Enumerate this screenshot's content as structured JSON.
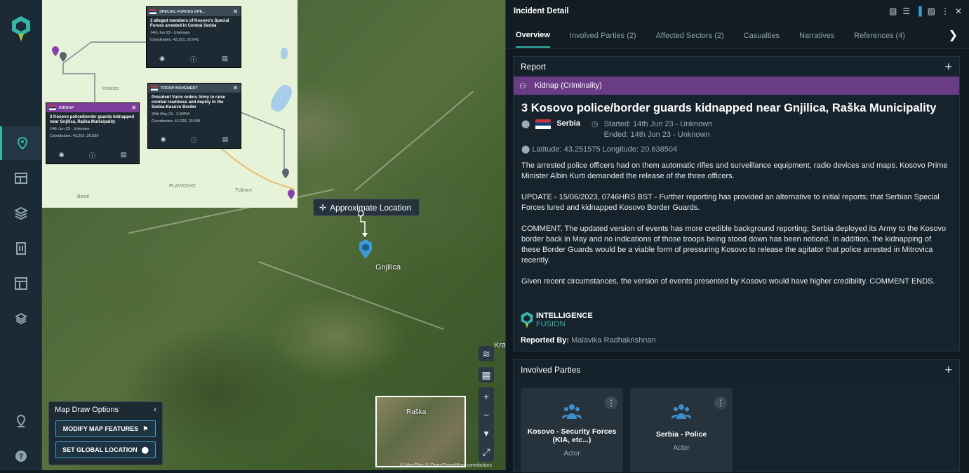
{
  "sidebar": {
    "items": [
      "map",
      "dashboard",
      "layers",
      "buildings",
      "layout",
      "stack",
      "location",
      "help"
    ]
  },
  "inset": {
    "labels": {
      "kravice": "Kravice",
      "plavkovo": "PLAVKOVO",
      "tusnice": "Tušnice",
      "bocin": "Bocin"
    },
    "cards": [
      {
        "tag": "SPECIAL FORCES OPE...",
        "title": "3 alleged members of Kosovo's Special Forces arrested in Central Serbia",
        "date": "14th Jun 23 - Unknown",
        "coords": "Coordinates: 43.251, 20.641"
      },
      {
        "tag": "TROOP MOVEMENT",
        "title": "President Vucic orders Army to raise combat readiness and deploy to the Serbia-Kosovo Border",
        "date": "26th May 23 - 2:00PM",
        "coords": "Coordinates: 43.228, 20.698"
      },
      {
        "tag": "KIDNAP",
        "title": "3 Kosovo police/border guards kidnapped near Gnjilica, Raška Municipality",
        "date": "14th Jun 23 - Unknown",
        "coords": "Coordinates: 43.252, 20.639"
      }
    ]
  },
  "map": {
    "approx_label": "Approximate Location",
    "place_label": "Gnjilica",
    "edge_label": "Kra",
    "minimap_label": "Raška",
    "attribution": "© MapTiler © OpenStreetMap contributors"
  },
  "draw_options": {
    "title": "Map Draw Options",
    "modify": "MODIFY MAP FEATURES",
    "set_global": "SET GLOBAL LOCATION"
  },
  "panel": {
    "title": "Incident Detail",
    "tabs": [
      "Overview",
      "Involved Parties (2)",
      "Affected Sectors (2)",
      "Casualties",
      "Narratives",
      "References (4)"
    ],
    "report": {
      "section": "Report",
      "category": "Kidnap (Criminality)",
      "headline": "3 Kosovo police/border guards kidnapped near Gnjilica, Raška Municipality",
      "country": "Serbia",
      "started": "Started: 14th Jun 23 - Unknown",
      "ended": "Ended: 14th Jun 23 - Unknown",
      "latlon": "Latitude: 43.251575 Longitude: 20.638504",
      "paragraphs": [
        "The arrested police officers had on them automatic rifles and surveillance equipment, radio devices and maps. Kosovo Prime Minister Albin Kurti demanded the release of the three officers.",
        "UPDATE - 15/06/2023, 0746HRS BST - Further reporting has provided an alternative to initial reports; that Serbian Special Forces lured and kidnapped Kosovo Border Guards.",
        "COMMENT. The updated version of events has more credible background reporting; Serbia deployed its Army to the Kosovo border back in May and no indications of those troops being stood down has been noticed. In addition, the kidnapping of these Border Guards would be a viable form of pressuring Kosovo to release the agitator that police arrested in Mitrovica recently.",
        "Given recent circumstances, the version of events presented by Kosovo would have higher credibility. COMMENT ENDS."
      ],
      "brand_line1": "INTELLIGENCE",
      "brand_line2": "FUSION",
      "reported_by_label": "Reported By:",
      "reported_by": "Malavika Radhakrishnan"
    },
    "parties": {
      "section": "Involved Parties",
      "items": [
        {
          "name": "Kosovo - Security Forces (KIA, etc...)",
          "role": "Actor"
        },
        {
          "name": "Serbia - Police",
          "role": "Actor"
        }
      ]
    }
  }
}
